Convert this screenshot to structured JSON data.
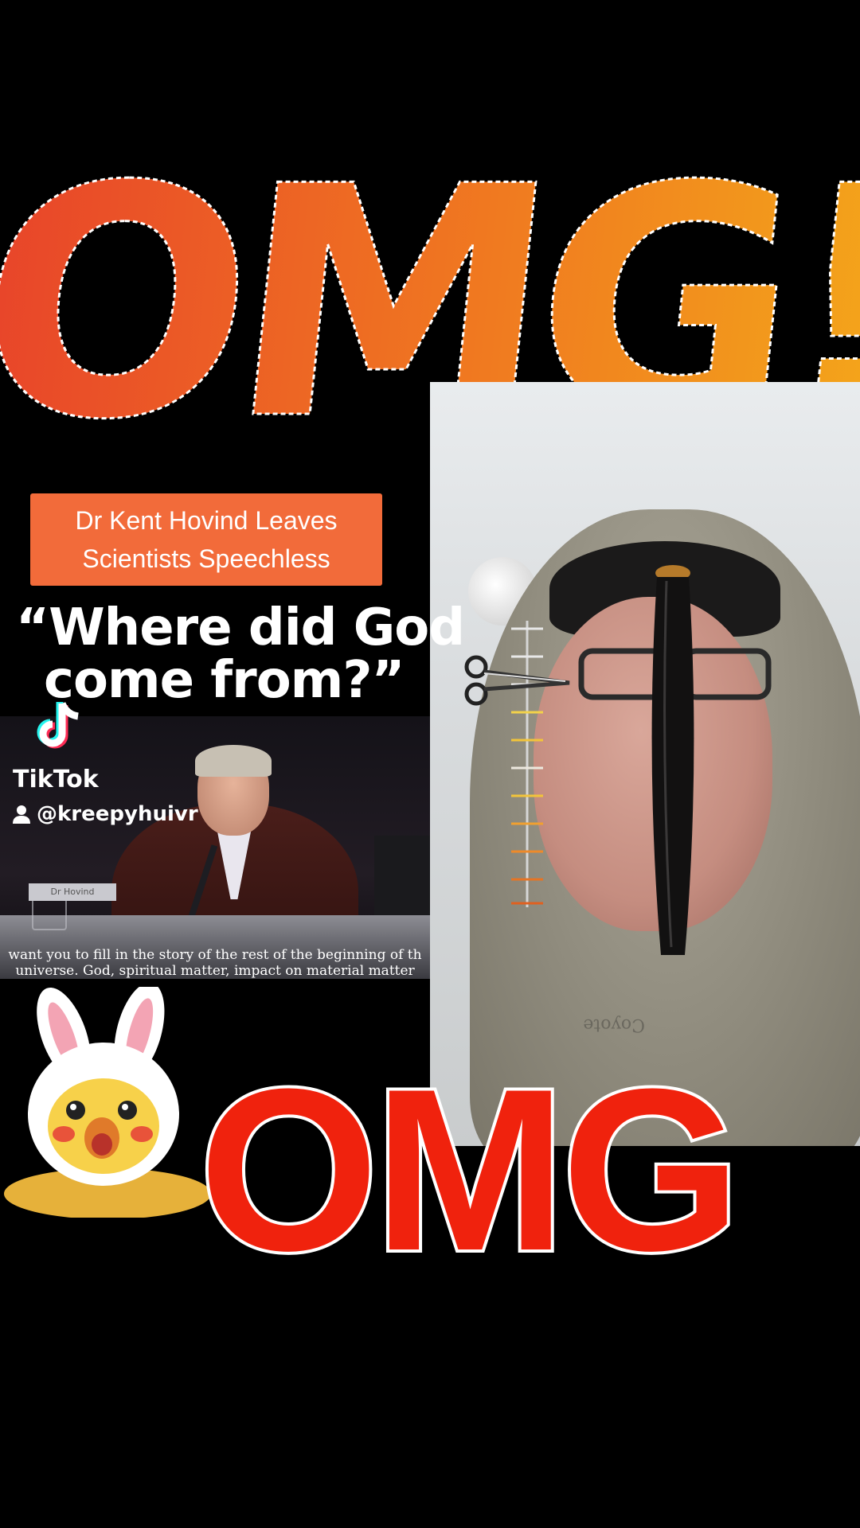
{
  "stickers": {
    "omg_top": "OMG!",
    "omg_bottom": "OMG"
  },
  "headline": {
    "line1": "Dr Kent Hovind Leaves",
    "line2": "Scientists Speechless"
  },
  "quote": {
    "line1": "“Where did God",
    "line2": "come from?”"
  },
  "watermark": {
    "app": "TikTok",
    "user": "@kreepyhuivr"
  },
  "video": {
    "subtitle_line1": "want you to fill in the story of the rest of the beginning of th",
    "subtitle_line2": "universe. God, spiritual matter, impact on material matter",
    "name_plate": "Dr Hovind"
  },
  "camera": {
    "hoodie_text": "Coyote"
  },
  "colors": {
    "omg_top_start": "#e8442a",
    "omg_top_end": "#f4a81a",
    "omg_bottom": "#f0220d",
    "headline_box": "#f26b3a",
    "background": "#000000"
  },
  "icons": [
    "tiktok-logo-icon",
    "user-icon",
    "scissors-icon",
    "ruler-icon",
    "bunny-chick-sticker"
  ]
}
